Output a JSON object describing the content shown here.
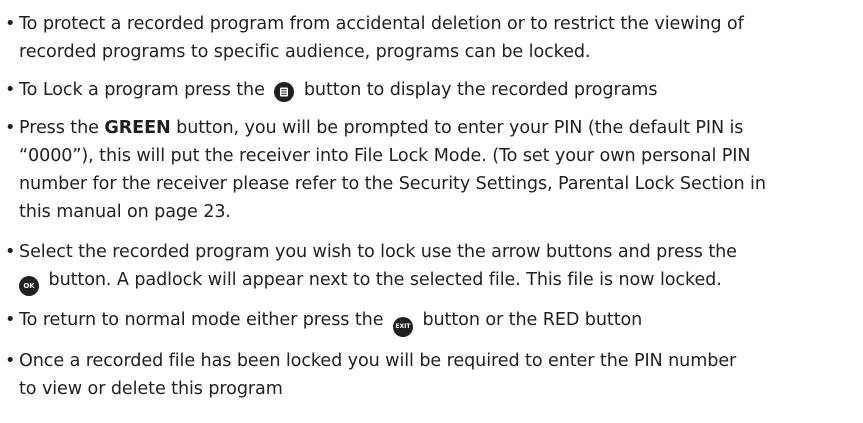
{
  "bullet_char": "•",
  "items": [
    {
      "lines": [
        "To protect a recorded program from accidental deletion or to restrict the viewing of",
        "recorded programs to specific audience, programs can be locked."
      ]
    },
    {
      "before": "To Lock a program press the",
      "icon": "list-button-icon",
      "after": "button to display the recorded programs"
    },
    {
      "pre": "Press the",
      "bold": "GREEN",
      "post": "button, you will be prompted to enter your PIN (the default PIN is",
      "lines": [
        "“0000”), this will  put the receiver into File Lock Mode. (To set your own personal PIN",
        "number for the receiver please refer to the Security Settings, Parental Lock Section in",
        "this manual on page 23."
      ]
    },
    {
      "line1": "Select the recorded program you wish to lock use the arrow buttons and press the",
      "icon": "ok-button-icon",
      "icon_text": "OK",
      "after": "button. A padlock will appear next to the selected file. This file is now locked."
    },
    {
      "before": "To return to normal mode either press the",
      "icon": "exit-button-icon",
      "icon_text": "EXIT",
      "after": "button or the RED button"
    },
    {
      "lines": [
        "Once a recorded file has been locked you will be required to enter the PIN number",
        "to view or delete this program"
      ]
    }
  ]
}
